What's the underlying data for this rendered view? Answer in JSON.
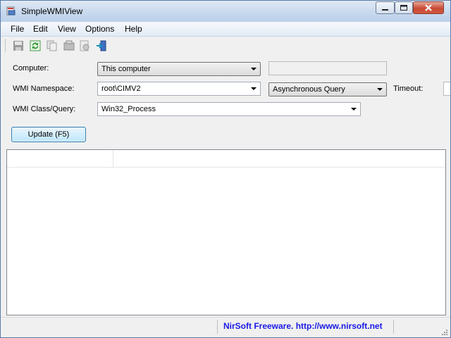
{
  "window": {
    "title": "SimpleWMIView"
  },
  "menu": [
    "File",
    "Edit",
    "View",
    "Options",
    "Help"
  ],
  "toolbar": {
    "icons": [
      "save-icon",
      "refresh-icon",
      "copy-icon",
      "properties-icon",
      "html-report-icon",
      "exit-icon"
    ]
  },
  "form": {
    "computer_label": "Computer:",
    "computer_value": "This computer",
    "namespace_label": "WMI Namespace:",
    "namespace_value": "root\\CIMV2",
    "query_mode_value": "Asynchronous Query",
    "timeout_label": "Timeout:",
    "class_label": "WMI Class/Query:",
    "class_value": "Win32_Process",
    "update_button": "Update (F5)"
  },
  "status": {
    "link_text": "NirSoft Freeware.  http://www.nirsoft.net"
  },
  "colors": {
    "link": "#1a1ae6",
    "title_gradient_top": "#dfe9f5",
    "close_button": "#c84a34"
  }
}
